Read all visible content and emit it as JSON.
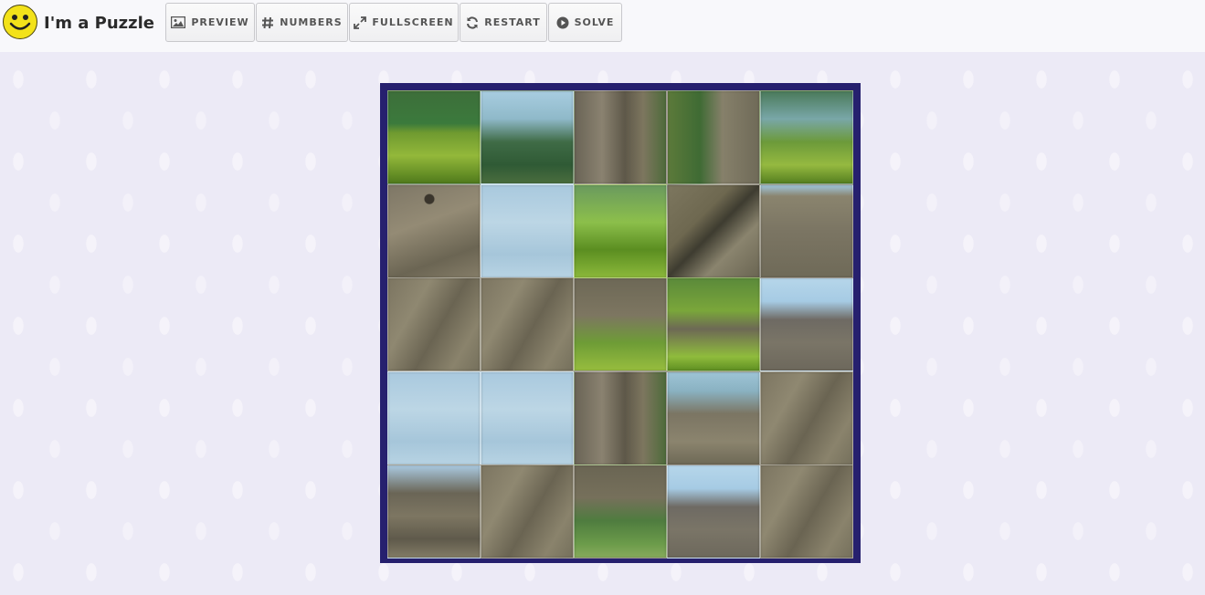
{
  "header": {
    "title": "I'm a Puzzle",
    "buttons": [
      {
        "label": "PREVIEW",
        "icon": "image-icon"
      },
      {
        "label": "NUMBERS",
        "icon": "hash-icon"
      },
      {
        "label": "FULLSCREEN",
        "icon": "expand-icon"
      },
      {
        "label": "RESTART",
        "icon": "refresh-icon"
      },
      {
        "label": "SOLVE",
        "icon": "play-circle-icon"
      }
    ]
  },
  "colors": {
    "topbar": "#f8f8fb",
    "page_background": "#eceaf6",
    "board_frame": "#26206e",
    "logo_yellow": "#f3e21a"
  },
  "puzzle": {
    "rows": 5,
    "cols": 5,
    "tiles": [
      [
        "grass",
        "palm-sky",
        "dino-leg",
        "palm-dino",
        "grass-leg"
      ],
      [
        "dino-eye",
        "sky",
        "grass",
        "dino-frill",
        "dino-body"
      ],
      [
        "dino-skin",
        "dino-skin",
        "dino-leg-grass",
        "grass-dino",
        "dino-frill-sky"
      ],
      [
        "sky",
        "sky",
        "dino-leg",
        "dino-back",
        "dino-skin"
      ],
      [
        "dino-horn",
        "dino-skin",
        "dino-grass",
        "dino-frill-sky",
        "dino-skin"
      ]
    ]
  }
}
